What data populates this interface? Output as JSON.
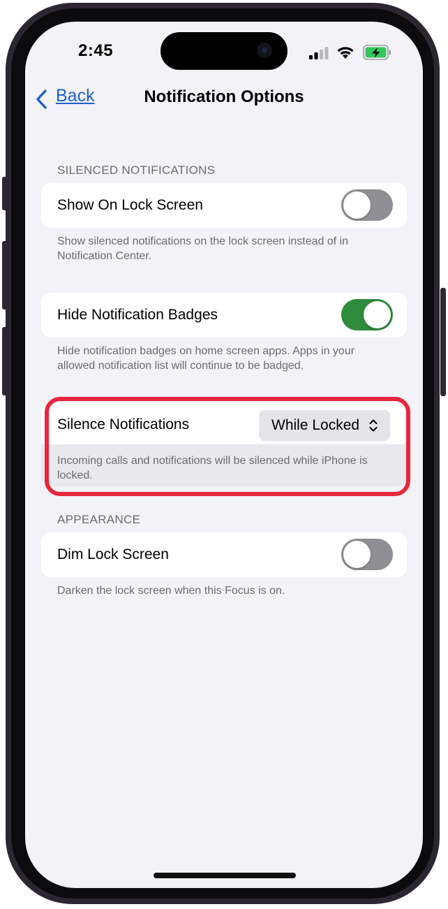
{
  "status_bar": {
    "time": "2:45",
    "icons": [
      "cellular-signal-icon",
      "wifi-icon",
      "battery-charging-icon"
    ],
    "battery_color": "#34c759"
  },
  "nav": {
    "back_label": "Back",
    "title": "Notification Options"
  },
  "sections": {
    "silenced": {
      "header": "SILENCED NOTIFICATIONS",
      "show_on_lock": {
        "label": "Show On Lock Screen",
        "on": false,
        "footer": "Show silenced notifications on the lock screen instead of in Notification Center."
      },
      "hide_badges": {
        "label": "Hide Notification Badges",
        "on": true,
        "footer": "Hide notification badges on home screen apps. Apps in your allowed notification list will continue to be badged."
      },
      "silence": {
        "label": "Silence Notifications",
        "value": "While Locked",
        "footer": "Incoming calls and notifications will be silenced while iPhone is locked."
      }
    },
    "appearance": {
      "header": "APPEARANCE",
      "dim_lock": {
        "label": "Dim Lock Screen",
        "on": false,
        "footer": "Darken the lock screen when this Focus is on."
      }
    }
  },
  "colors": {
    "accent": "#2060c8",
    "toggle_on": "#2f8b3c",
    "toggle_off": "#8e8e93",
    "highlight": "#e8263e",
    "background": "#f2f2f7"
  }
}
